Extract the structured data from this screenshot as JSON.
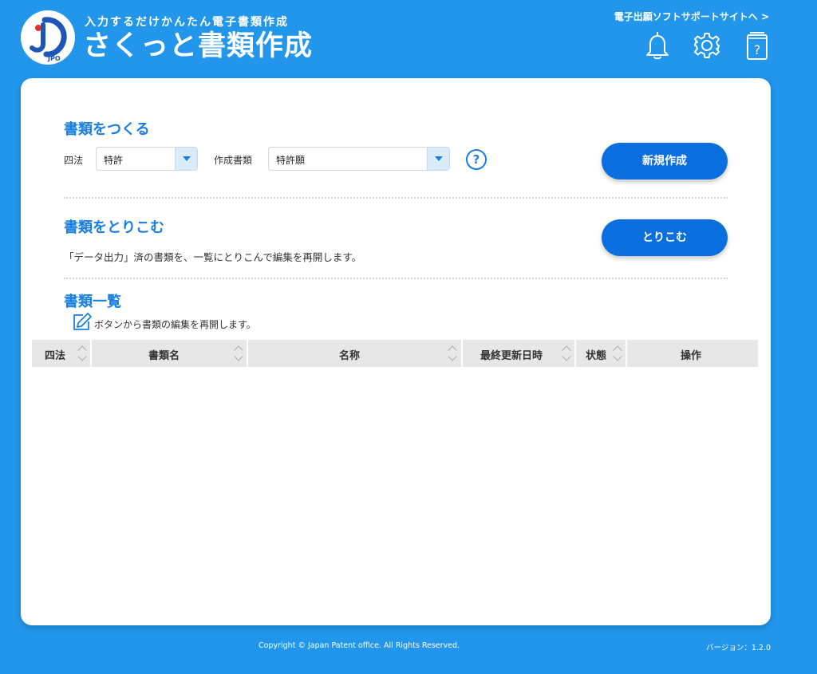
{
  "header": {
    "logo_text": "JPO",
    "tagline": "入力するだけかんたん電子書類作成",
    "app_title": "さくっと書類作成",
    "support_link": "電子出願ソフトサポートサイトへ >"
  },
  "create_section": {
    "title": "書類をつくる",
    "law_label": "四法",
    "law_value": "特許",
    "doc_label": "作成書類",
    "doc_value": "特許願",
    "help_glyph": "?",
    "new_button": "新規作成"
  },
  "import_section": {
    "title": "書類をとりこむ",
    "description": "「データ出力」済の書類を、一覧にとりこんで編集を再開します。",
    "import_button": "とりこむ"
  },
  "list_section": {
    "title": "書類一覧",
    "hint": "ボタンから書類の編集を再開します。",
    "columns": [
      "四法",
      "書類名",
      "名称",
      "最終更新日時",
      "状態",
      "操作"
    ]
  },
  "footer": {
    "copyright": "Copyright © Japan Patent office. All Rights Reserved.",
    "version": "バージョン：1.2.0"
  },
  "colors": {
    "background": "#2196ea",
    "accent": "#1a7fe0",
    "button": "#0b6fe0"
  },
  "icons": [
    "bell-icon",
    "gear-icon",
    "help-book-icon",
    "edit-icon",
    "sort-icon"
  ]
}
